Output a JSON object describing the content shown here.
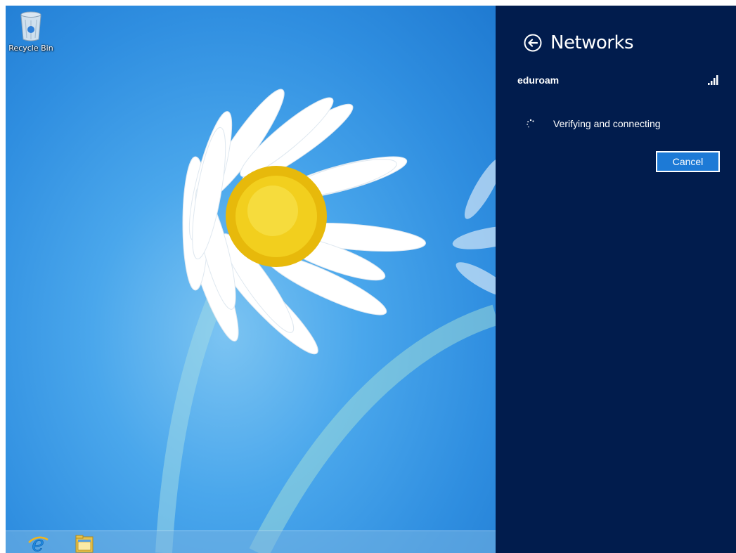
{
  "desktop": {
    "icons": [
      {
        "label": "Recycle Bin",
        "icon": "recycle-bin-icon"
      }
    ],
    "wallpaper": "daisy-flower-on-blue"
  },
  "taskbar": {
    "items": [
      {
        "name": "Internet Explorer",
        "icon": "internet-explorer-icon"
      },
      {
        "name": "File Explorer",
        "icon": "file-explorer-icon"
      }
    ]
  },
  "charm": {
    "title": "Networks",
    "back_icon": "back-arrow-circle-icon",
    "background": "#011c4d",
    "network": {
      "name": "eduroam",
      "signal_icon": "wifi-signal-bars-icon"
    },
    "status": {
      "text": "Verifying and connecting",
      "icon": "spinner-icon"
    },
    "cancel_label": "Cancel",
    "accent": "#1d7ad6"
  }
}
